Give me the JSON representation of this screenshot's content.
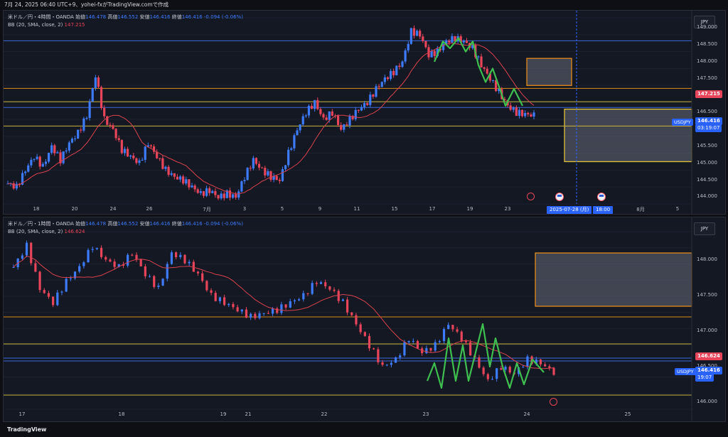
{
  "topbar": {
    "text": "7月 24, 2025 06:40 UTC+9、yohei-fxがTradingView.comで作成"
  },
  "pane1": {
    "symbol": "米ドル／円・4時間・OANDA",
    "o_label": "始値",
    "o": "146.478",
    "h_label": "高値",
    "h": "146.552",
    "l_label": "安値",
    "l": "146.416",
    "c_label": "終値",
    "c": "146.416",
    "chg": "-0.094 (-0.06%)",
    "bb_label": "BB (20, SMA, close, 2)",
    "bb_value": "147.215",
    "currency": "JPY",
    "yticks": [
      "149.000",
      "148.500",
      "148.000",
      "147.500",
      "147.000",
      "146.500",
      "146.000",
      "145.500",
      "145.000",
      "144.500",
      "144.000"
    ],
    "xticks": [
      "18",
      "20",
      "24",
      "26",
      "7月",
      "3",
      "5",
      "9",
      "11",
      "15",
      "17",
      "19",
      "23",
      "8月",
      "5"
    ],
    "price_tag_bb": "147.215",
    "sym_tag": "USDJPY",
    "price_tag_last": "146.416",
    "countdown": "03:19:07",
    "crosshair_date": "2025-07-28 (月)",
    "crosshair_time": "18:00"
  },
  "pane2": {
    "symbol": "米ドル／円・1時間・OANDA",
    "o_label": "始値",
    "o": "146.478",
    "h_label": "高値",
    "h": "146.552",
    "l_label": "安値",
    "l": "146.416",
    "c_label": "終値",
    "c": "146.416",
    "chg": "-0.094 (-0.06%)",
    "bb_label": "BB (20, SMA, close, 2)",
    "bb_value": "146.624",
    "currency": "JPY",
    "yticks": [
      "148.000",
      "147.500",
      "147.000",
      "146.500",
      "146.000"
    ],
    "xticks": [
      "17",
      "18",
      "19",
      "21",
      "22",
      "23",
      "24",
      "25"
    ],
    "price_tag_bb": "146.624",
    "sym_tag": "USDJPY",
    "price_tag_last": "146.416",
    "countdown": "19:07"
  },
  "footer": {
    "brand": "TradingView"
  },
  "colors": {
    "up": "#3d7bfb",
    "down": "#e8445a",
    "bb": "#d9424f",
    "wave": "#3fbf4f",
    "hline_orange": "#d98a1a",
    "hline_yellow": "#c9b43a",
    "hline_blue": "#3d68d8"
  },
  "chart_data": [
    {
      "type": "candlestick",
      "timeframe": "4H",
      "ylim": [
        143.8,
        149.3
      ],
      "close_path": [
        144.4,
        144.3,
        144.8,
        145.2,
        144.9,
        145.5,
        145.1,
        145.6,
        145.9,
        146.4,
        147.6,
        146.3,
        146.0,
        145.4,
        145.2,
        145.0,
        145.6,
        145.2,
        144.8,
        144.6,
        144.5,
        144.3,
        144.1,
        144.2,
        144.0,
        144.1,
        144.0,
        144.6,
        145.1,
        144.8,
        144.6,
        144.5,
        145.3,
        146.0,
        146.5,
        146.8,
        146.3,
        146.5,
        146.0,
        146.3,
        146.6,
        146.8,
        147.2,
        147.5,
        147.7,
        148.0,
        148.9,
        148.8,
        148.2,
        148.3,
        148.6,
        148.7,
        148.6,
        148.4,
        147.9,
        147.5,
        147.1,
        146.7,
        146.5,
        146.45,
        146.42
      ],
      "h_lines": [
        148.62,
        147.215,
        146.82,
        146.65,
        146.1
      ],
      "boxes": [
        "148.1–147.3 (orange)",
        "146.6–145.05 (yellow)"
      ]
    },
    {
      "type": "candlestick",
      "timeframe": "1H",
      "ylim": [
        145.9,
        148.4
      ],
      "close_path": [
        147.9,
        148.2,
        147.6,
        147.4,
        147.7,
        147.9,
        148.2,
        148.0,
        147.9,
        148.1,
        147.8,
        147.6,
        148.1,
        148.0,
        147.8,
        147.5,
        147.4,
        147.3,
        147.2,
        147.25,
        147.3,
        147.4,
        147.5,
        147.7,
        147.6,
        147.4,
        147.1,
        146.8,
        146.5,
        146.6,
        146.9,
        146.7,
        146.8,
        147.1,
        146.9,
        146.6,
        146.3,
        146.5,
        146.4,
        146.6,
        146.55,
        146.42
      ],
      "h_lines": [
        147.2,
        146.82,
        146.62,
        146.58,
        146.1
      ],
      "boxes": [
        "148.1–147.35 (orange)"
      ]
    }
  ]
}
